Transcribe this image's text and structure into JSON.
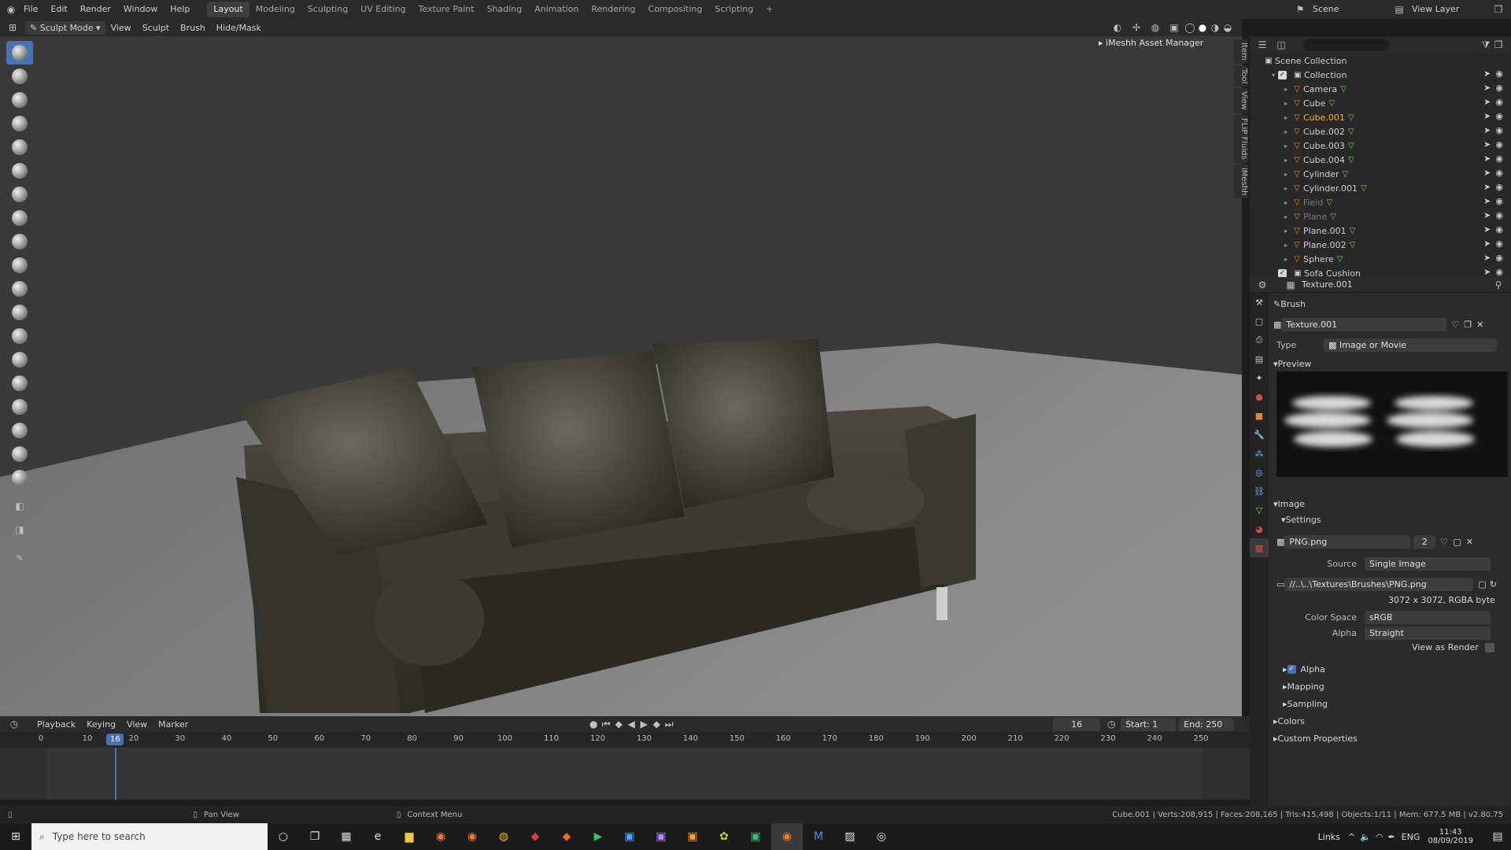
{
  "topbar": {
    "menus": [
      "File",
      "Edit",
      "Render",
      "Window",
      "Help"
    ],
    "workspaces": [
      "Layout",
      "Modeling",
      "Sculpting",
      "UV Editing",
      "Texture Paint",
      "Shading",
      "Animation",
      "Rendering",
      "Compositing",
      "Scripting"
    ],
    "active_workspace": "Layout",
    "add_tab": "+",
    "scene_label": "Scene",
    "view_layer_label": "View Layer"
  },
  "viewport_header": {
    "mode": "Sculpt Mode",
    "menus": [
      "View",
      "Sculpt",
      "Brush",
      "Hide/Mask"
    ],
    "asset_manager": "iMeshh Asset Manager",
    "side_tabs": [
      "Item",
      "Tool",
      "View",
      "FLIP Fluids",
      "iMeshh"
    ]
  },
  "outliner": {
    "root": "Scene Collection",
    "collection": "Collection",
    "items": [
      {
        "name": "Camera",
        "state": "normal"
      },
      {
        "name": "Cube",
        "state": "normal"
      },
      {
        "name": "Cube.001",
        "state": "selected"
      },
      {
        "name": "Cube.002",
        "state": "normal"
      },
      {
        "name": "Cube.003",
        "state": "normal"
      },
      {
        "name": "Cube.004",
        "state": "normal"
      },
      {
        "name": "Cylinder",
        "state": "normal"
      },
      {
        "name": "Cylinder.001",
        "state": "normal"
      },
      {
        "name": "Field",
        "state": "dim"
      },
      {
        "name": "Plane",
        "state": "dim"
      },
      {
        "name": "Plane.001",
        "state": "normal"
      },
      {
        "name": "Plane.002",
        "state": "normal"
      },
      {
        "name": "Sphere",
        "state": "normal"
      }
    ],
    "second_collection": "Sofa Cushion"
  },
  "properties": {
    "title": "Texture.001",
    "brush_label": "Brush",
    "texture_name": "Texture.001",
    "type_label": "Type",
    "type_value": "Image or Movie",
    "preview_label": "Preview",
    "image_label": "Image",
    "settings_label": "Settings",
    "image_name": "PNG.png",
    "users": "2",
    "source_label": "Source",
    "source_value": "Single Image",
    "filepath": "//..\\..\\Textures\\Brushes\\PNG.png",
    "resolution": "3072 x 3072,  RGBA byte",
    "color_space_label": "Color Space",
    "color_space_value": "sRGB",
    "alpha_label": "Alpha",
    "alpha_value": "Straight",
    "view_as_render": "View as Render",
    "sections": [
      "Alpha",
      "Mapping",
      "Sampling"
    ],
    "colors_label": "Colors",
    "custom_props_label": "Custom Properties"
  },
  "timeline": {
    "menus": [
      "Playback",
      "Keying",
      "View",
      "Marker"
    ],
    "current_frame": "16",
    "start_label": "Start:",
    "start": "1",
    "end_label": "End:",
    "end": "250",
    "ticks": [
      "0",
      "10",
      "20",
      "30",
      "40",
      "50",
      "60",
      "70",
      "80",
      "90",
      "100",
      "110",
      "120",
      "130",
      "140",
      "150",
      "160",
      "170",
      "180",
      "190",
      "200",
      "210",
      "220",
      "230",
      "240",
      "250"
    ]
  },
  "statusbar": {
    "pan": "Pan View",
    "context": "Context Menu",
    "stats": "Cube.001 | Verts:208,915 | Faces:208,165 | Tris:415,498 | Objects:1/11 | Mem: 677.5 MB | v2.80.75"
  },
  "taskbar": {
    "search_placeholder": "Type here to search",
    "links": "Links",
    "lang": "ENG",
    "time": "11:43",
    "date": "08/09/2019"
  }
}
